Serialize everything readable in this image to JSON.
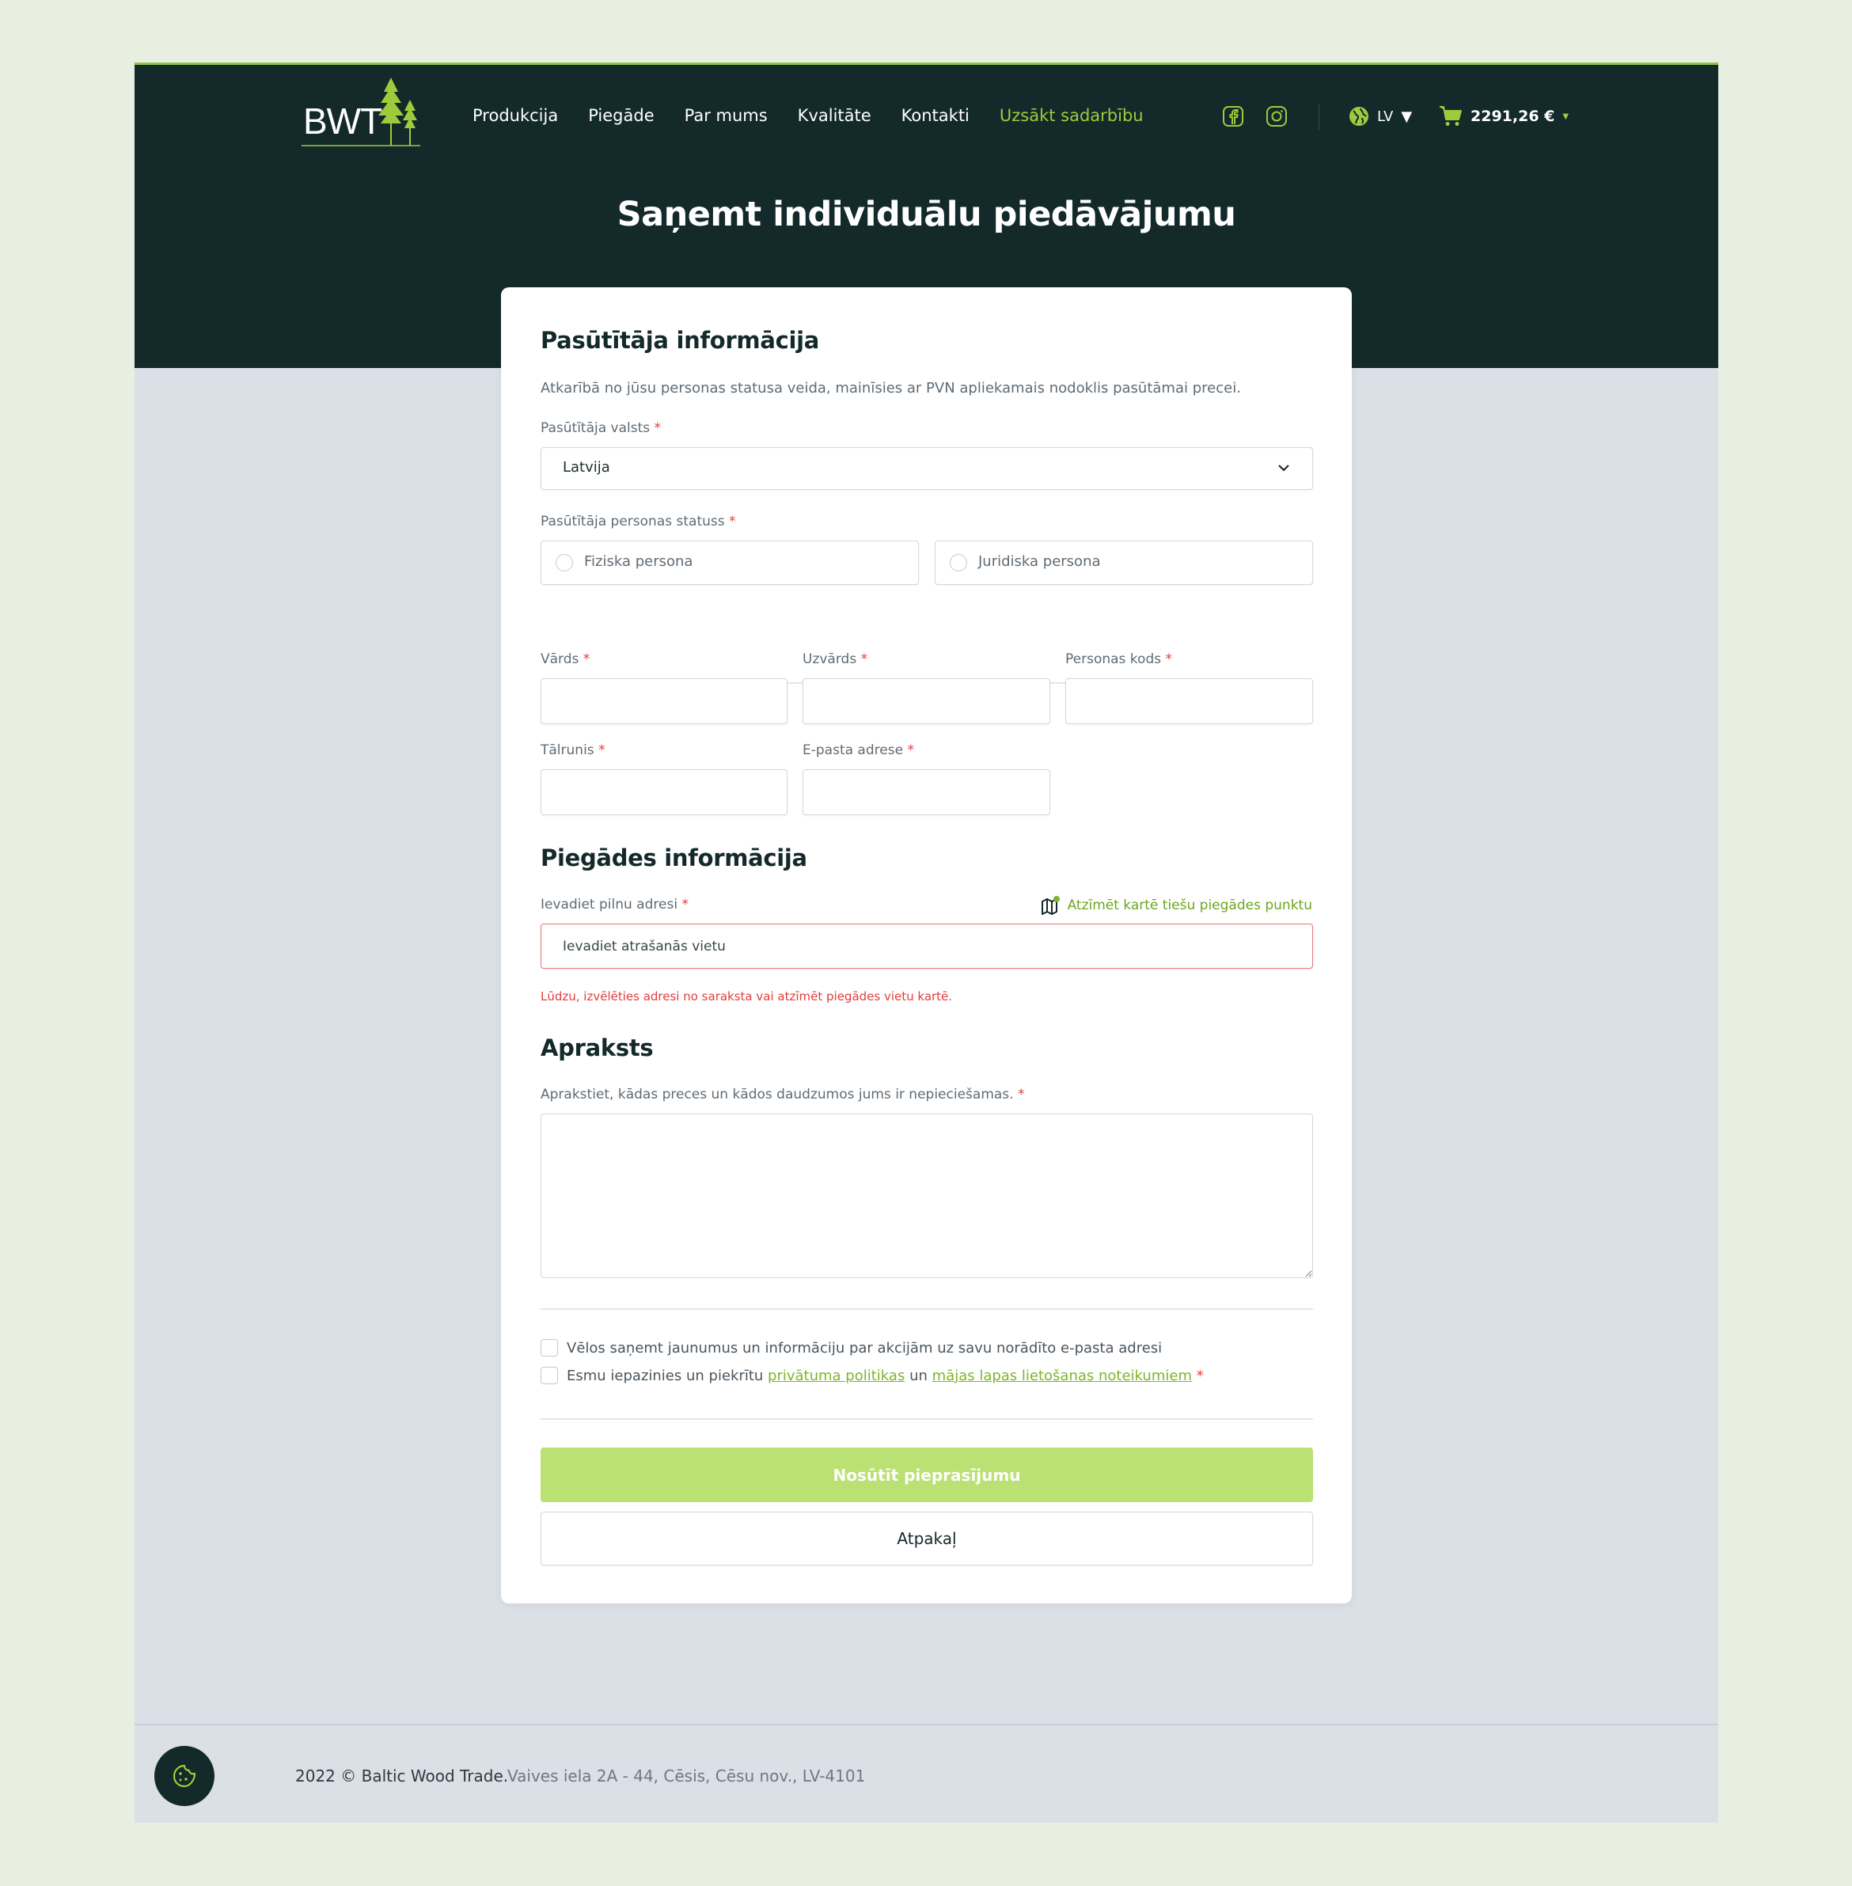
{
  "header": {
    "logo_text": "BWT",
    "nav": [
      "Produkcija",
      "Piegāde",
      "Par mums",
      "Kvalitāte",
      "Kontakti",
      "Uzsākt sadarbību"
    ],
    "language": "LV",
    "cart_total": "2291,26 €",
    "icons": [
      "facebook-icon",
      "instagram-icon",
      "globe-icon",
      "cart-icon"
    ]
  },
  "page_title": "Saņemt individuālu piedāvājumu",
  "customer_info": {
    "heading": "Pasūtītāja informācija",
    "note": "Atkarībā no jūsu personas statusa veida, mainīsies ar PVN apliekamais nodoklis pasūtāmai precei.",
    "country_label": "Pasūtītāja valsts",
    "country_value": "Latvija",
    "status_label": "Pasūtītāja personas statuss",
    "status_options": [
      "Fiziska persona",
      "Juridiska persona"
    ],
    "first_name_label": "Vārds",
    "last_name_label": "Uzvārds",
    "personal_code_label": "Personas kods",
    "phone_label": "Tālrunis",
    "email_label": "E-pasta adrese",
    "required_mark": "*"
  },
  "delivery_info": {
    "heading": "Piegādes informācija",
    "address_label": "Ievadiet pilnu adresi",
    "map_link": "Atzīmēt kartē tiešu piegādes punktu",
    "address_placeholder": "Ievadiet atrašanās vietu",
    "error": "Lūdzu, izvēlēties adresi no saraksta vai atzīmēt piegādes vietu kartē."
  },
  "description": {
    "heading": "Apraksts",
    "label": "Aprakstiet, kādas preces un kādos daudzumos jums ir nepieciešamas."
  },
  "consents": {
    "newsletter": "Vēlos saņemt jaunumus un informāciju par akcijām uz savu norādīto e-pasta adresi",
    "terms_prefix": "Esmu iepazinies un piekrītu",
    "privacy_link": "privātuma politikas",
    "terms_and": "un",
    "terms_link": "mājas lapas lietošanas noteikumiem"
  },
  "buttons": {
    "submit": "Nosūtīt pieprasījumu",
    "back": "Atpakaļ"
  },
  "footer": {
    "copyright": "2022 © Baltic Wood Trade.",
    "address": "Vaives iela 2A - 44, Cēsis, Cēsu nov., LV-4101"
  },
  "colors": {
    "dark": "#13292a",
    "accent": "#9ccc3c",
    "button": "#bbe074",
    "error": "#e23c3c"
  }
}
